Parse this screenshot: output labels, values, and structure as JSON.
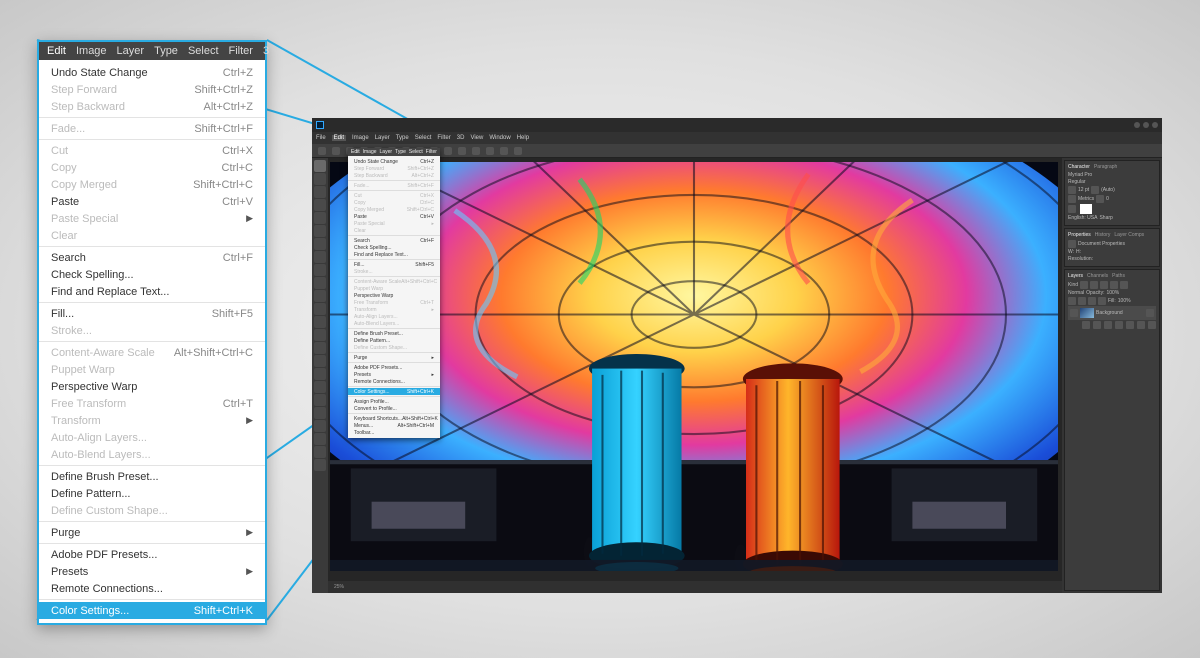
{
  "menubar_big": [
    "Edit",
    "Image",
    "Layer",
    "Type",
    "Select",
    "Filter",
    "3"
  ],
  "menu": {
    "s1": [
      {
        "l": "Undo State Change",
        "s": "Ctrl+Z"
      },
      {
        "l": "Step Forward",
        "s": "Shift+Ctrl+Z",
        "d": true
      },
      {
        "l": "Step Backward",
        "s": "Alt+Ctrl+Z",
        "d": true
      }
    ],
    "s2": [
      {
        "l": "Fade...",
        "s": "Shift+Ctrl+F",
        "d": true
      }
    ],
    "s3": [
      {
        "l": "Cut",
        "s": "Ctrl+X",
        "d": true
      },
      {
        "l": "Copy",
        "s": "Ctrl+C",
        "d": true
      },
      {
        "l": "Copy Merged",
        "s": "Shift+Ctrl+C",
        "d": true
      },
      {
        "l": "Paste",
        "s": "Ctrl+V"
      },
      {
        "l": "Paste Special",
        "sub": true,
        "d": true
      },
      {
        "l": "Clear",
        "d": true
      }
    ],
    "s4": [
      {
        "l": "Search",
        "s": "Ctrl+F"
      },
      {
        "l": "Check Spelling..."
      },
      {
        "l": "Find and Replace Text..."
      }
    ],
    "s5": [
      {
        "l": "Fill...",
        "s": "Shift+F5"
      },
      {
        "l": "Stroke...",
        "d": true
      }
    ],
    "s6": [
      {
        "l": "Content-Aware Scale",
        "s": "Alt+Shift+Ctrl+C",
        "d": true
      },
      {
        "l": "Puppet Warp",
        "d": true
      },
      {
        "l": "Perspective Warp"
      },
      {
        "l": "Free Transform",
        "s": "Ctrl+T",
        "d": true
      },
      {
        "l": "Transform",
        "sub": true,
        "d": true
      },
      {
        "l": "Auto-Align Layers...",
        "d": true
      },
      {
        "l": "Auto-Blend Layers...",
        "d": true
      }
    ],
    "s7": [
      {
        "l": "Define Brush Preset..."
      },
      {
        "l": "Define Pattern..."
      },
      {
        "l": "Define Custom Shape...",
        "d": true
      }
    ],
    "s8": [
      {
        "l": "Purge",
        "sub": true
      }
    ],
    "s9": [
      {
        "l": "Adobe PDF Presets..."
      },
      {
        "l": "Presets",
        "sub": true
      },
      {
        "l": "Remote Connections..."
      }
    ],
    "s10": [
      {
        "l": "Color Settings...",
        "s": "Shift+Ctrl+K",
        "hl": true
      }
    ],
    "s11": [
      {
        "l": "Assign Profile..."
      },
      {
        "l": "Convert to Profile..."
      }
    ],
    "s12": [
      {
        "l": "Keyboard Shortcuts...",
        "s": "Alt+Shift+Ctrl+K"
      },
      {
        "l": "Menus...",
        "s": "Alt+Shift+Ctrl+M"
      },
      {
        "l": "Toolbar..."
      }
    ]
  },
  "app_menubar": [
    "File",
    "Edit",
    "Image",
    "Layer",
    "Type",
    "Select",
    "Filter",
    "3D",
    "View",
    "Window",
    "Help"
  ],
  "panels": {
    "char": {
      "tabs": [
        "Character",
        "Paragraph"
      ],
      "font": "Myriad Pro",
      "style": "Regular",
      "size": "12 pt",
      "leading": "(Auto)",
      "tracking": "0",
      "kerning": "Metrics",
      "lang": "English: USA",
      "aa": "Sharp"
    },
    "props": {
      "tabs": [
        "Properties",
        "History",
        "Layer Comps"
      ],
      "title": "Document Properties",
      "w": "W:",
      "wval": "",
      "h": "H:",
      "hval": "",
      "res": "Resolution:"
    },
    "layers": {
      "tabs": [
        "Layers",
        "Channels",
        "Paths"
      ],
      "kind": "Kind",
      "mode": "Normal",
      "opacity": "Opacity:",
      "opval": "100%",
      "fill": "Fill:",
      "fillval": "100%",
      "bg": "Background"
    }
  },
  "status": {
    "zoom": "25%"
  },
  "colors": {
    "highlight": "#29abe2"
  }
}
